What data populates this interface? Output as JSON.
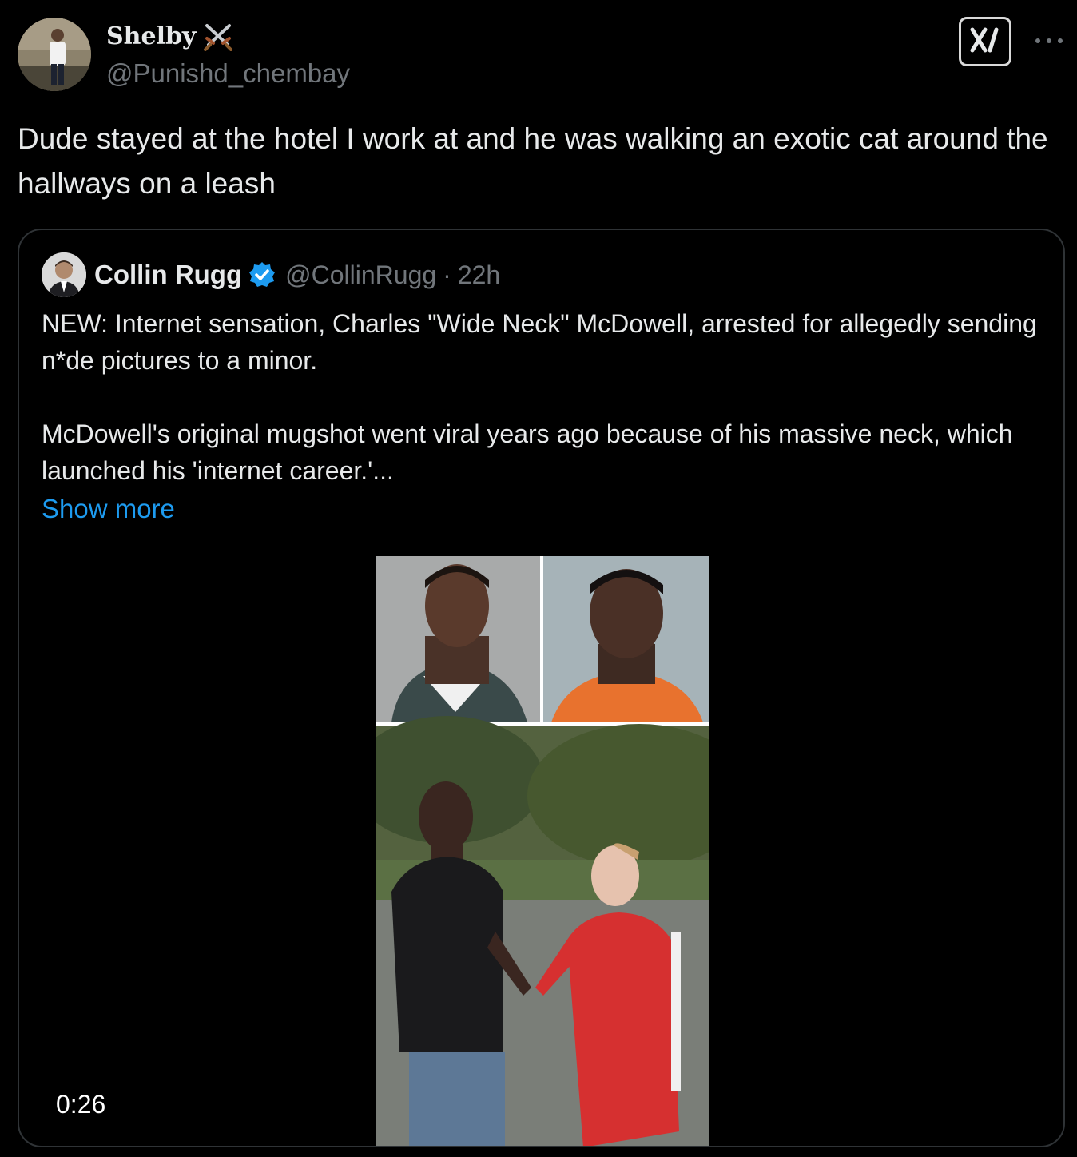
{
  "colors": {
    "background": "#000000",
    "text_primary": "#e7e9ea",
    "text_secondary": "#71767b",
    "link": "#1d9bf0",
    "border": "#2f3336",
    "verified": "#1d9bf0"
  },
  "tweet": {
    "author": {
      "display_name": "Shelby",
      "handle": "@Punishd_chembay",
      "name_emoji_icon": "crossed-swords-icon"
    },
    "text": "Dude stayed at the hotel I work at and he was walking an exotic cat around the hallways on a leash",
    "actions": {
      "grok_icon": "grok-icon",
      "more_icon": "more-horizontal-icon"
    }
  },
  "quoted_tweet": {
    "author": {
      "display_name": "Collin Rugg",
      "handle": "@CollinRugg",
      "separator": "·",
      "time": "22h",
      "verified_icon": "verified-badge-icon"
    },
    "paragraph_1": "NEW: Internet sensation, Charles \"Wide Neck\" McDowell, arrested for allegedly sending n*de pictures to a minor.",
    "paragraph_2": "McDowell's original mugshot went viral years ago because of his massive neck, which launched his 'internet career.'...",
    "show_more": "Show more",
    "media": {
      "type": "video",
      "duration": "0:26"
    }
  }
}
